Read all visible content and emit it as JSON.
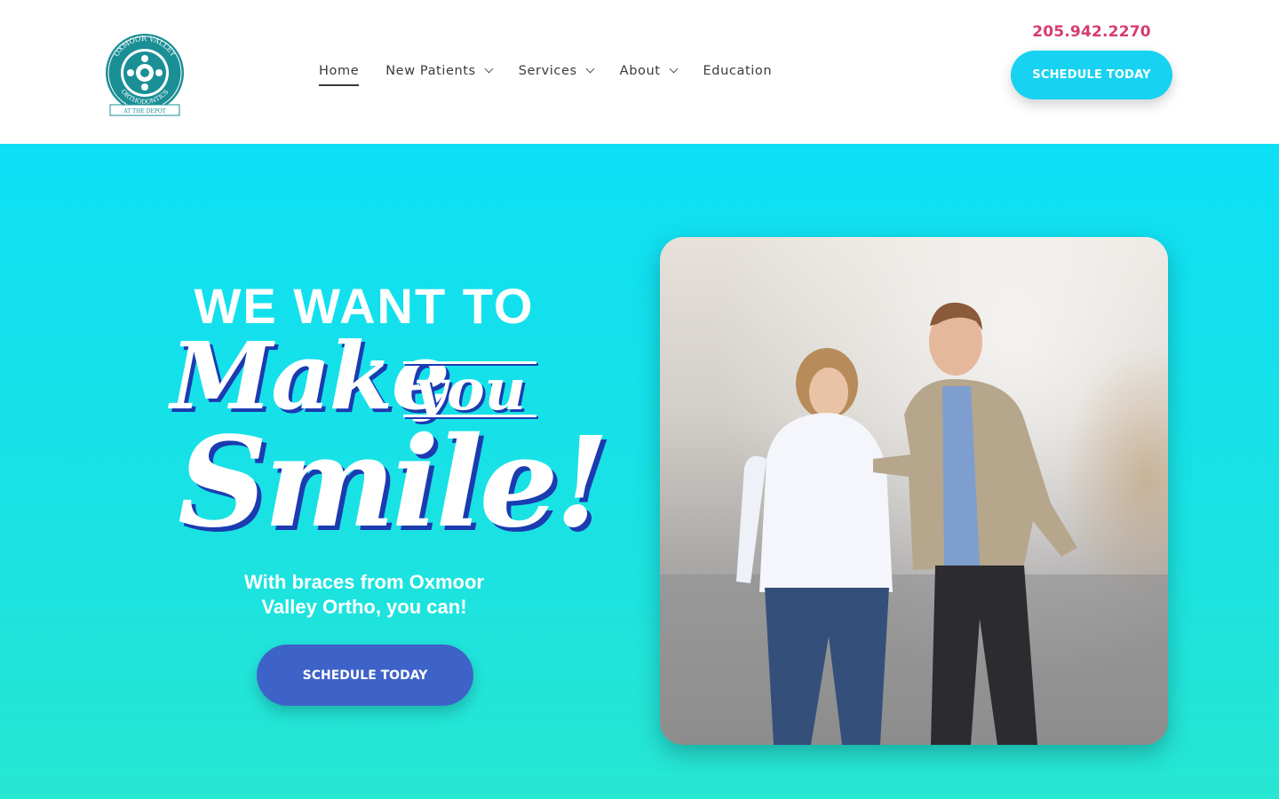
{
  "header": {
    "logo": {
      "top_text": "OXMOOR VALLEY",
      "bottom_text": "ORTHODONTICS",
      "banner_text": "AT THE DEPOT"
    },
    "nav": [
      {
        "label": "Home",
        "dropdown": false,
        "active": true
      },
      {
        "label": "New Patients",
        "dropdown": true
      },
      {
        "label": "Services",
        "dropdown": true
      },
      {
        "label": "About",
        "dropdown": true
      },
      {
        "label": "Education",
        "dropdown": false
      }
    ],
    "phone": "205.942.2270",
    "cta_label": "SCHEDULE TODAY"
  },
  "hero": {
    "line1": "WE WANT TO",
    "line2": "Make",
    "line2_accent": "you",
    "line3": "Smile!",
    "subtitle": "With braces from Oxmoor Valley Ortho, you can!",
    "cta_label": "SCHEDULE TODAY"
  },
  "colors": {
    "accent_cyan": "#17d2f0",
    "phone_pink": "#d63c6e",
    "hero_button_blue": "#3e63c8",
    "hero_gradient_top": "#0ddff5",
    "hero_gradient_bottom": "#27e6d2",
    "script_shadow": "#1b3bb0",
    "logo_teal": "#1a8f96"
  }
}
